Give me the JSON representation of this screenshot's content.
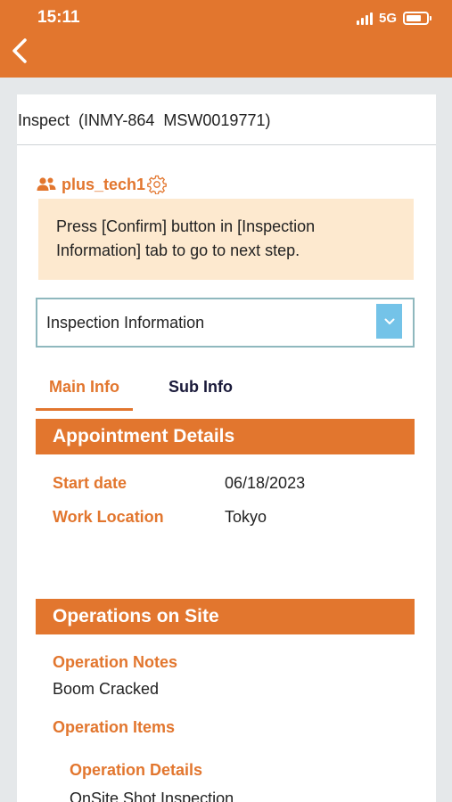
{
  "status_bar": {
    "time": "15:11",
    "network": "5G",
    "battery_level": 0.75
  },
  "header": {
    "back_icon": "chevron-left-icon"
  },
  "card": {
    "title": "Inspect  (INMY-864  MSW0019771)",
    "user": {
      "name": "plus_tech1",
      "icon": "users-icon",
      "settings_icon": "gear-icon"
    },
    "notice": "Press [Confirm] button in [Inspection Information] tab to go to next step.",
    "selector": {
      "value": "Inspection Information",
      "icon": "chevron-down-icon"
    },
    "tabs": [
      {
        "label": "Main Info",
        "active": true
      },
      {
        "label": "Sub Info",
        "active": false
      }
    ],
    "appointment": {
      "header": "Appointment Details",
      "start_date_label": "Start date",
      "start_date_value": "06/18/2023",
      "location_label": "Work Location",
      "location_value": "Tokyo"
    },
    "operations": {
      "header": "Operations on Site",
      "notes_label": "Operation Notes",
      "notes_value": "Boom Cracked",
      "items_label": "Operation Items",
      "details_label": "Operation Details",
      "details_value": "OnSite Shot Inspection"
    }
  },
  "colors": {
    "accent": "#e2762e",
    "notice_bg": "#fde9cf",
    "select_border": "#8fb8be",
    "select_arrow_bg": "#74c3e8",
    "page_bg": "#e5e8ea"
  }
}
